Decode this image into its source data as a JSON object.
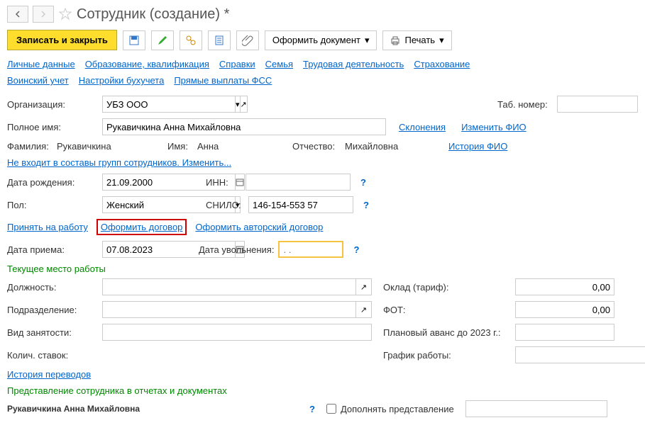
{
  "header": {
    "title": "Сотрудник (создание) *"
  },
  "toolbar": {
    "save_close": "Записать и закрыть",
    "doc_button": "Оформить документ",
    "print_button": "Печать"
  },
  "tabs": {
    "row1": {
      "personal": "Личные данные",
      "education": "Образование, квалификация",
      "references": "Справки",
      "family": "Семья",
      "labor": "Трудовая деятельность",
      "insurance": "Страхование"
    },
    "row2": {
      "military": "Воинский учет",
      "accounting": "Настройки бухучета",
      "fss": "Прямые выплаты ФСС"
    }
  },
  "form": {
    "org_label": "Организация:",
    "org_value": "УБЗ ООО",
    "tab_num_label": "Таб. номер:",
    "fullname_label": "Полное имя:",
    "fullname_value": "Рукавичкина Анна Михайловна",
    "declensions_link": "Склонения",
    "change_fio_link": "Изменить ФИО",
    "surname_label": "Фамилия:",
    "surname_value": "Рукавичкина",
    "name_label": "Имя:",
    "name_value": "Анна",
    "patronymic_label": "Отчество:",
    "patronymic_value": "Михайловна",
    "history_fio_link": "История ФИО",
    "groups_link": "Не входит в составы групп сотрудников. Изменить...",
    "birthdate_label": "Дата рождения:",
    "birthdate_value": "21.09.2000",
    "inn_label": "ИНН:",
    "gender_label": "Пол:",
    "gender_value": "Женский",
    "snils_label": "СНИЛС:",
    "snils_value": "146-154-553 57",
    "hire_link": "Принять на работу",
    "contract_link": "Оформить договор",
    "author_contract_link": "Оформить авторский договор",
    "hire_date_label": "Дата приема:",
    "hire_date_value": "07.08.2023",
    "fire_date_label": "Дата увольнения:",
    "fire_date_placeholder": ". .",
    "workplace_title": "Текущее место работы",
    "position_label": "Должность:",
    "salary_label": "Оклад (тариф):",
    "salary_value": "0,00",
    "department_label": "Подразделение:",
    "fot_label": "ФОТ:",
    "fot_value": "0,00",
    "employment_type_label": "Вид занятости:",
    "planned_advance_label": "Плановый аванс до 2023 г.:",
    "rate_count_label": "Колич. ставок:",
    "schedule_label": "График работы:",
    "transfers_history_link": "История переводов",
    "representation_title": "Представление сотрудника в отчетах и документах",
    "representation_name": "Рукавичкина Анна Михайловна",
    "supplement_label": "Дополнять представление"
  }
}
